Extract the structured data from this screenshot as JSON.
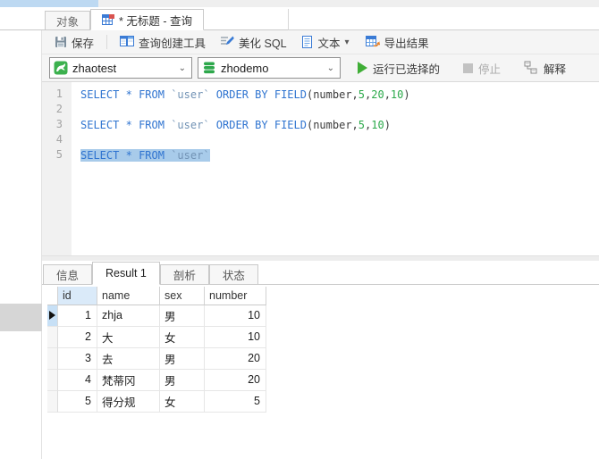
{
  "top_tabs": [
    {
      "label": "对象",
      "active": false
    },
    {
      "label": "* 无标题 - 查询",
      "active": true
    }
  ],
  "toolbar": {
    "save": "保存",
    "query_builder": "查询创建工具",
    "beautify_sql": "美化 SQL",
    "text": "文本",
    "export_result": "导出结果"
  },
  "connection_bar": {
    "connection": "zhaotest",
    "database": "zhodemo",
    "run_selected": "运行已选择的",
    "stop": "停止",
    "explain": "解释"
  },
  "editor": {
    "lines": [
      {
        "num": "1",
        "selected": false,
        "tokens": [
          [
            "kw",
            "SELECT"
          ],
          [
            "pl",
            " "
          ],
          [
            "kw",
            "*"
          ],
          [
            "pl",
            " "
          ],
          [
            "kw",
            "FROM"
          ],
          [
            "pl",
            " "
          ],
          [
            "id",
            "`user`"
          ],
          [
            "pl",
            " "
          ],
          [
            "kw",
            "ORDER"
          ],
          [
            "pl",
            " "
          ],
          [
            "kw",
            "BY"
          ],
          [
            "pl",
            " "
          ],
          [
            "kw",
            "FIELD"
          ],
          [
            "pl",
            "(number,"
          ],
          [
            "num",
            "5"
          ],
          [
            "pl",
            ","
          ],
          [
            "num",
            "20"
          ],
          [
            "pl",
            ","
          ],
          [
            "num",
            "10"
          ],
          [
            "pl",
            ")"
          ]
        ]
      },
      {
        "num": "2",
        "selected": false,
        "tokens": []
      },
      {
        "num": "3",
        "selected": false,
        "tokens": [
          [
            "kw",
            "SELECT"
          ],
          [
            "pl",
            " "
          ],
          [
            "kw",
            "*"
          ],
          [
            "pl",
            " "
          ],
          [
            "kw",
            "FROM"
          ],
          [
            "pl",
            " "
          ],
          [
            "id",
            "`user`"
          ],
          [
            "pl",
            " "
          ],
          [
            "kw",
            "ORDER"
          ],
          [
            "pl",
            " "
          ],
          [
            "kw",
            "BY"
          ],
          [
            "pl",
            " "
          ],
          [
            "kw",
            "FIELD"
          ],
          [
            "pl",
            "(number,"
          ],
          [
            "num",
            "5"
          ],
          [
            "pl",
            ","
          ],
          [
            "num",
            "10"
          ],
          [
            "pl",
            ")"
          ]
        ]
      },
      {
        "num": "4",
        "selected": false,
        "tokens": []
      },
      {
        "num": "5",
        "selected": true,
        "tokens": [
          [
            "kw",
            "SELECT"
          ],
          [
            "pl",
            " "
          ],
          [
            "kw",
            "*"
          ],
          [
            "pl",
            " "
          ],
          [
            "kw",
            "FROM"
          ],
          [
            "pl",
            " "
          ],
          [
            "id",
            "`user`"
          ]
        ]
      }
    ]
  },
  "result_tabs": [
    {
      "label": "信息",
      "active": false
    },
    {
      "label": "Result 1",
      "active": true
    },
    {
      "label": "剖析",
      "active": false
    },
    {
      "label": "状态",
      "active": false
    }
  ],
  "result_table": {
    "columns": [
      "id",
      "name",
      "sex",
      "number"
    ],
    "selected_header": "id",
    "rows": [
      {
        "selected": true,
        "cells": [
          "1",
          "zhja",
          "男",
          "10"
        ]
      },
      {
        "selected": false,
        "cells": [
          "2",
          "大",
          "女",
          "10"
        ]
      },
      {
        "selected": false,
        "cells": [
          "3",
          "去",
          "男",
          "20"
        ]
      },
      {
        "selected": false,
        "cells": [
          "4",
          "梵蒂冈",
          "男",
          "20"
        ]
      },
      {
        "selected": false,
        "cells": [
          "5",
          "得分规",
          "女",
          "5"
        ]
      }
    ]
  },
  "colors": {
    "keyword_blue": "#2f74d0",
    "number_green": "#2ba94a",
    "identifier_blue_gray": "#7293b5",
    "selection_blue": "#a8cbea",
    "header_highlight": "#daeaf9",
    "run_green": "#3fae36",
    "mysql_green": "#3cb14e",
    "titlebar_blue": "#bdd9f2"
  }
}
